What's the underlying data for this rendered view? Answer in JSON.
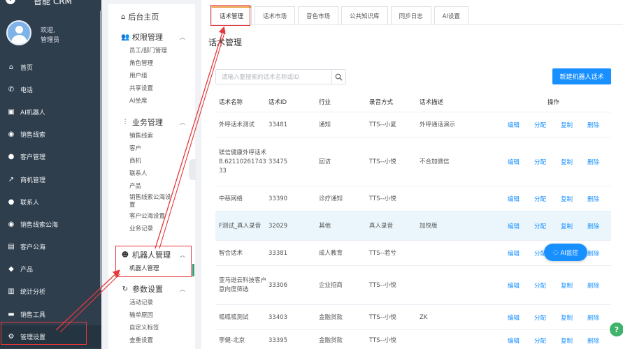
{
  "app": {
    "title": "智能 CRM",
    "logo_glyph": "!"
  },
  "user": {
    "welcome": "欢迎,",
    "role": "管理员"
  },
  "sidebar": {
    "items": [
      {
        "label": "首页",
        "icon": "home-icon",
        "glyph": "⌂"
      },
      {
        "label": "电话",
        "icon": "phone-icon",
        "glyph": "✆"
      },
      {
        "label": "AI机器人",
        "icon": "ai-robot-icon",
        "glyph": "▣"
      },
      {
        "label": "销售线索",
        "icon": "globe-icon",
        "glyph": "◉"
      },
      {
        "label": "客户管理",
        "icon": "users-icon",
        "glyph": "●"
      },
      {
        "label": "商机管理",
        "icon": "chart-line-icon",
        "glyph": "↗"
      },
      {
        "label": "联系人",
        "icon": "person-icon",
        "glyph": "●"
      },
      {
        "label": "销售线索公海",
        "icon": "globe-icon",
        "glyph": "◉"
      },
      {
        "label": "客户公海",
        "icon": "id-card-icon",
        "glyph": "▤"
      },
      {
        "label": "产品",
        "icon": "box-icon",
        "glyph": "◆"
      },
      {
        "label": "统计分析",
        "icon": "bar-chart-icon",
        "glyph": "▥"
      },
      {
        "label": "销售工具",
        "icon": "briefcase-icon",
        "glyph": "▬"
      },
      {
        "label": "管理设置",
        "icon": "gear-icon",
        "glyph": "⚙"
      }
    ]
  },
  "submenu": {
    "home": "后台主页",
    "groups": [
      {
        "title": "权限管理",
        "icon": "users-icon",
        "items": [
          "员工/部门管理",
          "角色管理",
          "用户组",
          "共享设置",
          "AI坐席"
        ]
      },
      {
        "title": "业务管理",
        "icon": "sliders-icon",
        "items": [
          "销售线索",
          "客户",
          "商机",
          "联系人",
          "产品",
          "销售线索公海设置",
          "客户公海设置",
          "业务记录"
        ]
      },
      {
        "title": "机器人管理",
        "icon": "robot-icon",
        "items": [
          "机器人管理"
        ]
      },
      {
        "title": "参数设置",
        "icon": "refresh-icon",
        "items": [
          "活动记录",
          "输单原因",
          "自定义标签",
          "查重设置"
        ]
      }
    ]
  },
  "tabs": [
    "话术管理",
    "话术市场",
    "音色市场",
    "公共知识库",
    "同步日志",
    "AI设置"
  ],
  "page": {
    "title": "话术管理",
    "search_placeholder": "请输入要搜索的话术名称或ID",
    "new_button": "新建机器人话术"
  },
  "table": {
    "columns": [
      "话术名称",
      "话术ID",
      "行业",
      "录音方式",
      "话术描述",
      "操作"
    ],
    "actions": [
      "编辑",
      "分配",
      "复制",
      "删除"
    ],
    "rows": [
      {
        "name": "外呼话术测试",
        "id": "33481",
        "industry": "通知",
        "voice": "TTS--小夏",
        "desc": "外呼通话演示"
      },
      {
        "name": "镁信健康外呼话术8.62110261743 33",
        "id": "33475",
        "industry": "回访",
        "voice": "TTS--小悦",
        "desc": "不合加微信"
      },
      {
        "name": "中慈网络",
        "id": "33390",
        "industry": "诊疗通知",
        "voice": "TTS--小悦",
        "desc": ""
      },
      {
        "name": "F测试_真人录音",
        "id": "32029",
        "industry": "其他",
        "voice": "真人录音",
        "desc": "加快版"
      },
      {
        "name": "智合话术",
        "id": "33381",
        "industry": "成人教育",
        "voice": "TTS--若兮",
        "desc": ""
      },
      {
        "name": "亚马逊云科技客户意向度筛选",
        "id": "33306",
        "industry": "企业招商",
        "voice": "TTS--小悦",
        "desc": ""
      },
      {
        "name": "呱呱呱测试",
        "id": "33403",
        "industry": "金融贷款",
        "voice": "TTS--小悦",
        "desc": "ZK"
      },
      {
        "name": "李健-北京",
        "id": "33395",
        "industry": "金融贷款",
        "voice": "TTS--小悦",
        "desc": ""
      }
    ]
  },
  "floating": {
    "monitor": "AI监控",
    "help": "?"
  },
  "colors": {
    "sidebar_bg": "#2f3e4d",
    "primary": "#1890ff",
    "annotation": "#e4393c",
    "tab_accent": "#e89a3c"
  }
}
